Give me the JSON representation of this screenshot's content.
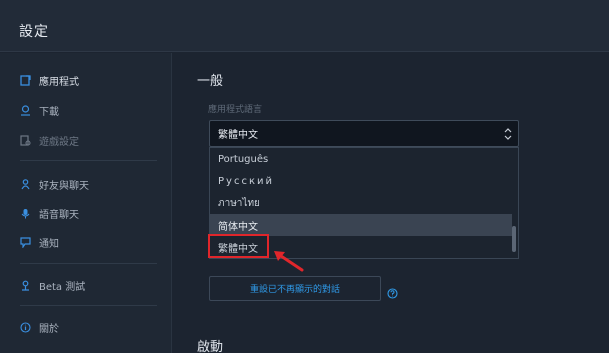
{
  "window": {
    "title": "設定"
  },
  "sidebar": {
    "items": [
      {
        "label": "應用程式",
        "icon": "app-icon"
      },
      {
        "label": "下載",
        "icon": "download-icon"
      },
      {
        "label": "遊戲設定",
        "icon": "game-settings-icon"
      },
      {
        "label": "好友與聊天",
        "icon": "friends-icon"
      },
      {
        "label": "語音聊天",
        "icon": "microphone-icon"
      },
      {
        "label": "通知",
        "icon": "notification-icon"
      },
      {
        "label": "Beta 測試",
        "icon": "beta-icon"
      },
      {
        "label": "關於",
        "icon": "info-icon"
      }
    ]
  },
  "main": {
    "general_heading": "一般",
    "language_label": "應用程式語言",
    "language_selected": "繁體中文",
    "language_options": [
      "Português",
      "Русский",
      "ภาษาไทย",
      "简体中文",
      "繁體中文"
    ],
    "highlighted_option": "简体中文",
    "reset_button_label": "重設已不再顯示的對話",
    "startup_heading": "啟動"
  },
  "colors": {
    "accent": "#2f9ae8",
    "annotation": "#e0262b"
  }
}
